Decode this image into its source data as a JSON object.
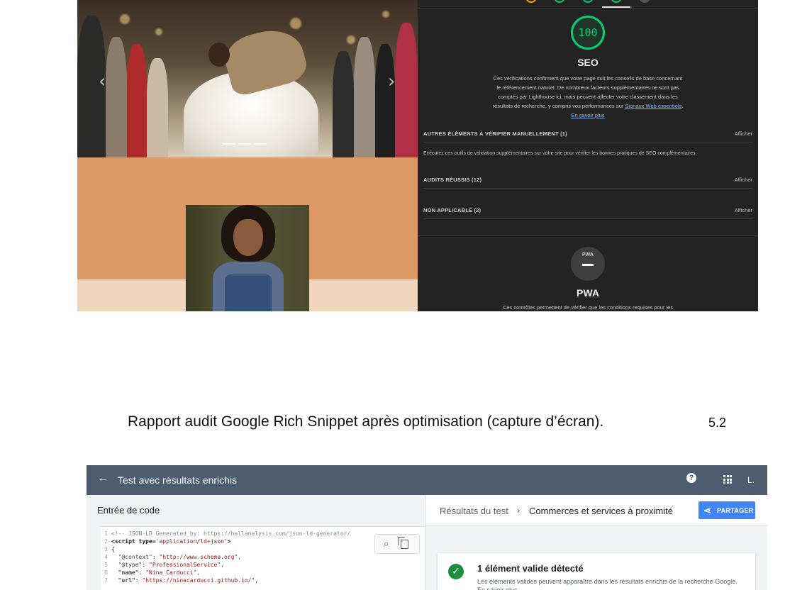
{
  "lighthouse": {
    "seo_score": "100",
    "seo_title": "SEO",
    "seo_description": "Ces vérifications confirment que votre page suit les conseils de base concernant le référencement naturel. De nombreux facteurs supplémentaires ne sont pas comptés par Lighthouse ici, mais peuvent affecter votre classement dans les résultats de recherche, y compris vos performances sur",
    "seo_link_vitals": "Signaux Web essentiels",
    "seo_link_more": "En savoir plus",
    "manual_label": "AUTRES ÉLÉMENTS À VÉRIFIER MANUELLEMENT (1)",
    "manual_note": "Exécutez ces outils de validation supplémentaires sur votre site pour vérifier les bonnes pratiques de SEO complémentaires.",
    "passed_label": "AUDITS RÉUSSIS (12)",
    "na_label": "NON APPLICABLE (2)",
    "show_label": "Afficher",
    "pwa_gauge_label": "PWA",
    "pwa_title": "PWA",
    "pwa_description": "Ces contrôles permettent de vérifier que les conditions requises pour les"
  },
  "caption": {
    "text": "Rapport audit Google Rich Snippet après optimisation (capture d’écran).",
    "number": "5.2"
  },
  "rich_results": {
    "header_title": "Test avec résultats enrichis",
    "account_initial": "L.",
    "help_glyph": "?",
    "code_pane_title": "Entrée de code",
    "code_lines": {
      "l1": "<!-- JSON-LD Generated by: https://hallanalysis.com/json-ld-generator/",
      "l2_tag": "<script",
      "l2_attr": "type=",
      "l2_val": "'application/ld+json'",
      "l2_end": ">",
      "l3": "{",
      "l4_key": "\"@context\"",
      "l4_val": "\"http://www.schema.org\",",
      "l5_key": "\"@type\"",
      "l5_val": "\"ProfessionalService\",",
      "l6_key": "\"name\"",
      "l6_val": "\"Nina Carducci\",",
      "l7_key": "\"url\"",
      "l7_val": "\"https://ninacarducci.github.io/\","
    },
    "breadcrumb_root": "Résultats du test",
    "breadcrumb_current": "Commerces et services à proximité",
    "share_label": "PARTAGER",
    "valid_title": "1 élément valide détecté",
    "valid_description": "Les éléments valides peuvent apparaître dans les résultats enrichis de la recherche Google. En savoir plus"
  },
  "colors": {
    "lighthouse_pass": "#0cce6b",
    "lighthouse_average": "#ffa400",
    "header_bg": "#4b5d6e",
    "share_button": "#4285f4",
    "valid_check": "#1e8e3e"
  }
}
